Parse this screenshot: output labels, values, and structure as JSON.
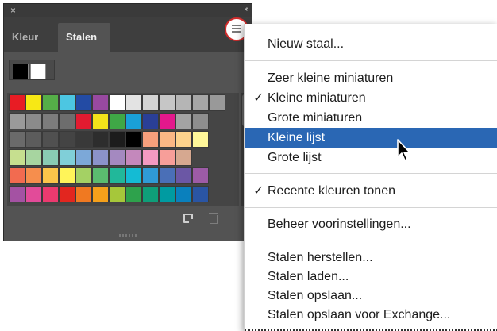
{
  "panel": {
    "close_glyph": "×",
    "collapse_glyph": "‹‹",
    "tabs": [
      {
        "label": "Kleur",
        "active": false
      },
      {
        "label": "Stalen",
        "active": true
      }
    ],
    "menu_button_icon": "hamburger-menu-icon",
    "fill_stroke": {
      "fill": "#000000",
      "stroke": "#ffffff"
    },
    "swatch_rows": [
      [
        "#e81c24",
        "#f7e815",
        "#55ae48",
        "#4cc6e2",
        "#234ba4",
        "#9849a0",
        "#ffffff",
        "#e3e3e3",
        "#d4d4d4",
        "#c6c6c6",
        "#b5b5b5",
        "#a6a6a6",
        "#999999",
        "#8a8a8a"
      ],
      [
        "#9a9a9a",
        "#8b8b8b",
        "#7c7c7c",
        "#6d6d6d",
        "#e21b30",
        "#f3e21a",
        "#3fa846",
        "#1aa0d8",
        "#2a3f97",
        "#e4188c",
        "#a3a3a3",
        "#8e8e8e"
      ],
      [
        "#6a6a6a",
        "#5c5c5c",
        "#505050",
        "#444444",
        "#393939",
        "#2d2d2d",
        "#1c1c1c",
        "#000000",
        "#f79f7c",
        "#fbb784",
        "#fdd28c",
        "#fff799"
      ],
      [
        "#c6df8f",
        "#a7d5a0",
        "#89cbb3",
        "#80cfd8",
        "#7ca8d8",
        "#8b93c9",
        "#a489c0",
        "#c488bc",
        "#f49ac1",
        "#f79e99",
        "#d6a890"
      ],
      [
        "#f26b50",
        "#f68e4d",
        "#fbc54a",
        "#fff459",
        "#a4d164",
        "#5bbb6f",
        "#21b89a",
        "#14bbd4",
        "#2f9bd6",
        "#4a6fb7",
        "#6b57a5",
        "#9d5ba6"
      ],
      [
        "#a452a3",
        "#e24b99",
        "#eb3a6f",
        "#e2261f",
        "#f07921",
        "#f5a01b",
        "#a6c73a",
        "#2ea24c",
        "#0f9e79",
        "#009ba1",
        "#0a80bd",
        "#2a55a4"
      ]
    ],
    "footer_icons": [
      "new-swatch-icon",
      "trash-icon"
    ]
  },
  "menu": {
    "items": [
      {
        "label": "Nieuw staal...",
        "checked": false,
        "selected": false
      },
      {
        "label": "Zeer kleine miniaturen",
        "checked": false,
        "selected": false
      },
      {
        "label": "Kleine miniaturen",
        "checked": true,
        "selected": false
      },
      {
        "label": "Grote miniaturen",
        "checked": false,
        "selected": false
      },
      {
        "label": "Kleine lijst",
        "checked": false,
        "selected": true
      },
      {
        "label": "Grote lijst",
        "checked": false,
        "selected": false
      },
      {
        "label": "Recente kleuren tonen",
        "checked": true,
        "selected": false
      },
      {
        "label": "Beheer voorinstellingen...",
        "checked": false,
        "selected": false
      },
      {
        "label": "Stalen herstellen...",
        "checked": false,
        "selected": false
      },
      {
        "label": "Stalen laden...",
        "checked": false,
        "selected": false
      },
      {
        "label": "Stalen opslaan...",
        "checked": false,
        "selected": false
      },
      {
        "label": "Stalen opslaan voor Exchange...",
        "checked": false,
        "selected": false
      }
    ],
    "check_glyph": "✓",
    "highlight_color": "#2a67b4"
  },
  "cursor_icon": "arrow-cursor-icon"
}
